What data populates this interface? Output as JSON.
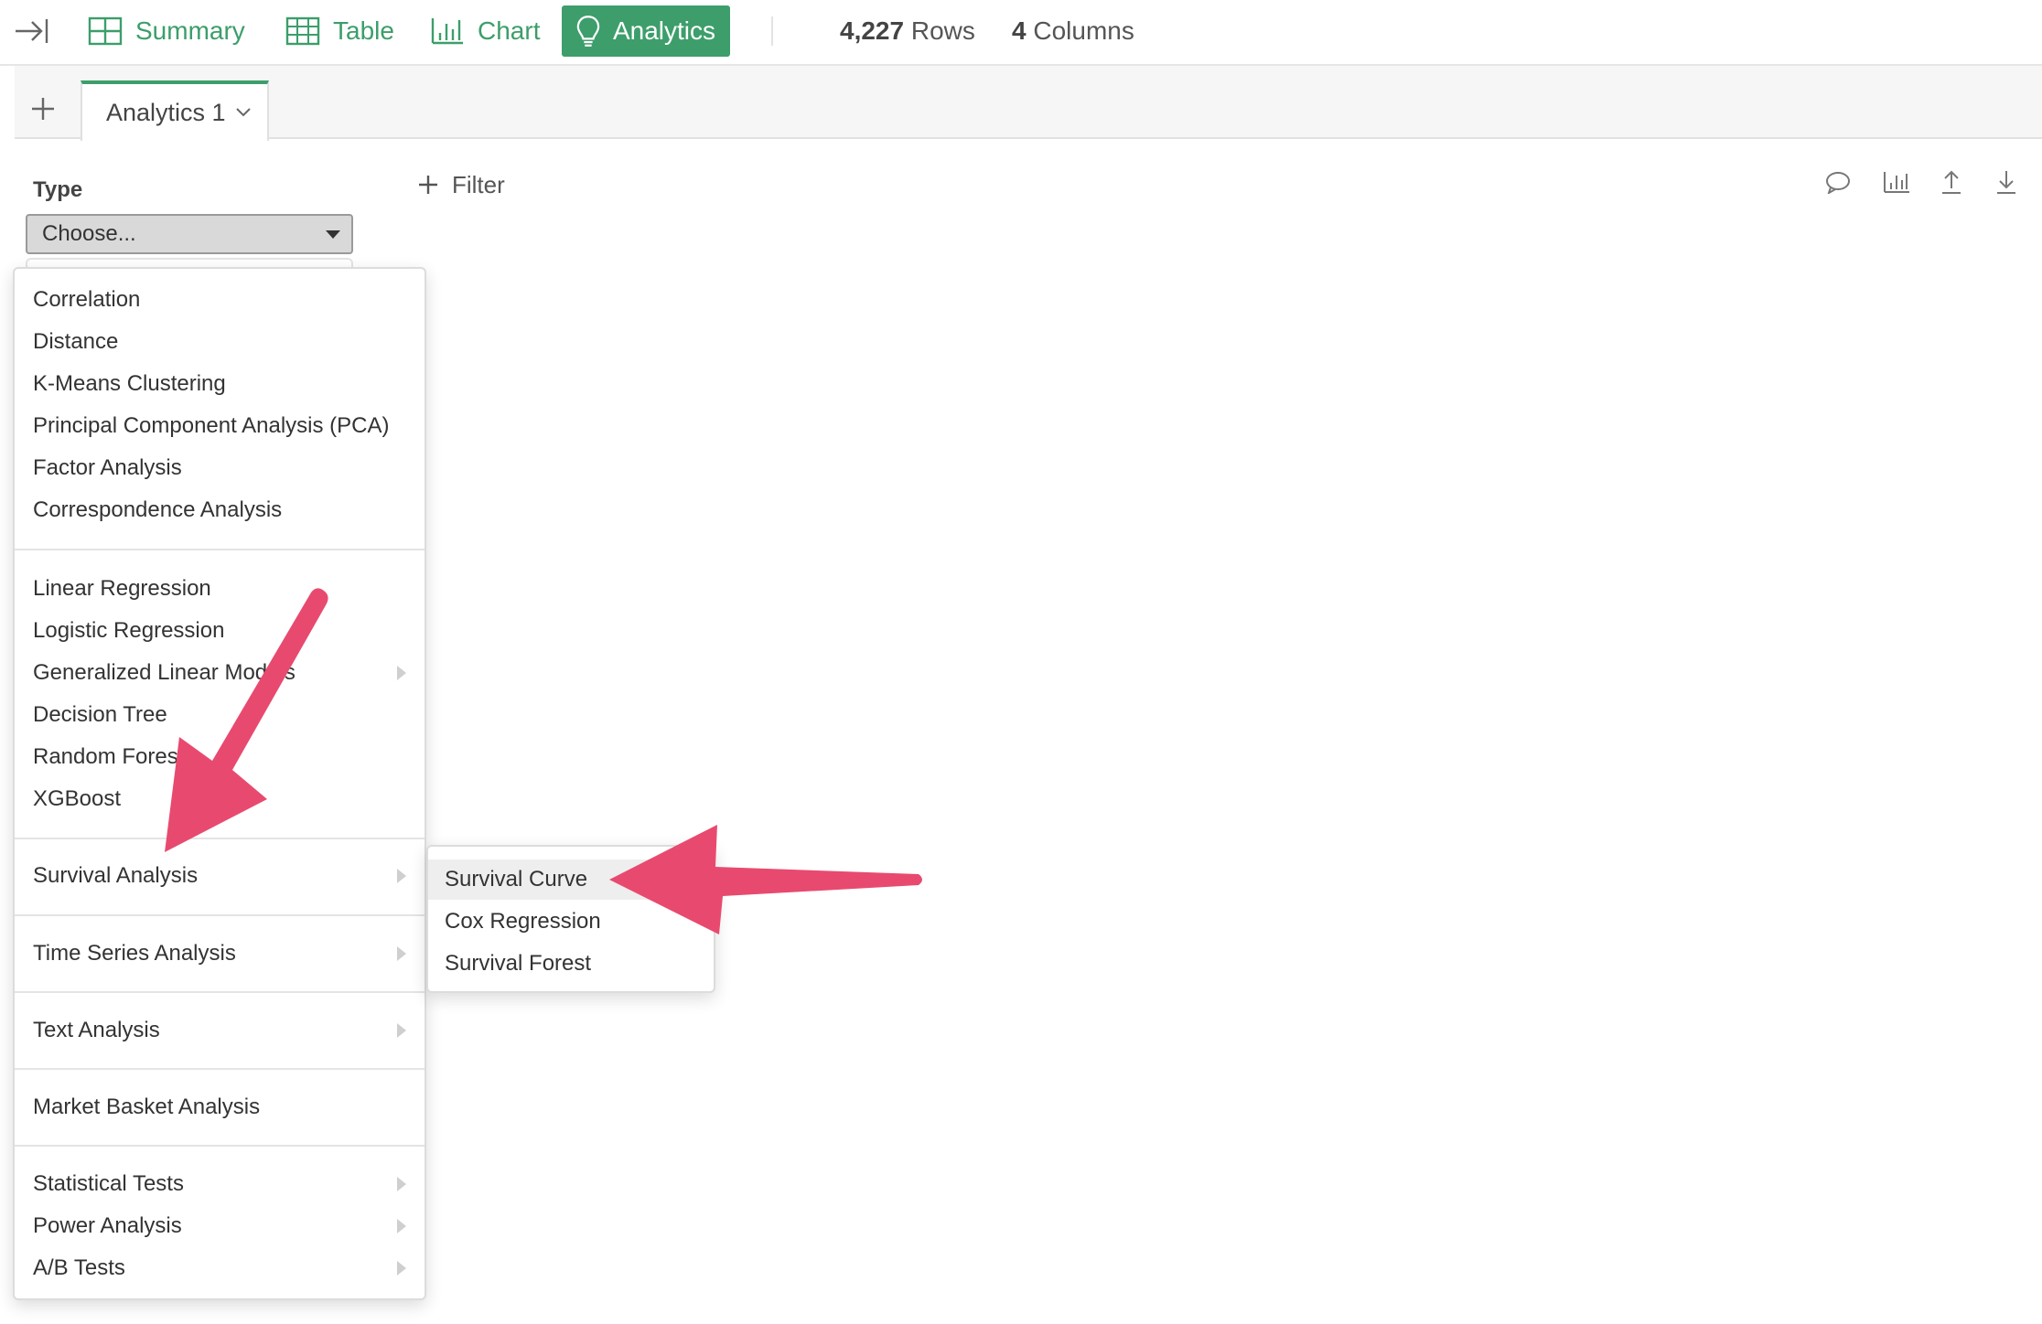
{
  "toolbar": {
    "nav": [
      {
        "label": "Summary",
        "icon": "summary-grid-icon",
        "active": false
      },
      {
        "label": "Table",
        "icon": "table-grid-icon",
        "active": false
      },
      {
        "label": "Chart",
        "icon": "bar-chart-icon",
        "active": false
      },
      {
        "label": "Analytics",
        "icon": "lightbulb-icon",
        "active": true
      }
    ],
    "rows_count": "4,227",
    "rows_label": "Rows",
    "columns_count": "4",
    "columns_label": "Columns"
  },
  "tabs": {
    "add_icon": "plus-icon",
    "items": [
      {
        "label": "Analytics 1",
        "active": true
      }
    ]
  },
  "config": {
    "type_label": "Type",
    "type_select_value": "Choose..."
  },
  "filter": {
    "label": "Filter"
  },
  "right_tools": [
    "comment-icon",
    "chart-icon",
    "upload-icon",
    "download-icon"
  ],
  "menu": {
    "groups": [
      [
        {
          "label": "Correlation",
          "has_submenu": false
        },
        {
          "label": "Distance",
          "has_submenu": false
        },
        {
          "label": "K-Means Clustering",
          "has_submenu": false
        },
        {
          "label": "Principal Component Analysis (PCA)",
          "has_submenu": false
        },
        {
          "label": "Factor Analysis",
          "has_submenu": false
        },
        {
          "label": "Correspondence Analysis",
          "has_submenu": false
        }
      ],
      [
        {
          "label": "Linear Regression",
          "has_submenu": false
        },
        {
          "label": "Logistic Regression",
          "has_submenu": false
        },
        {
          "label": "Generalized Linear Models",
          "has_submenu": true
        },
        {
          "label": "Decision Tree",
          "has_submenu": false
        },
        {
          "label": "Random Forest",
          "has_submenu": false
        },
        {
          "label": "XGBoost",
          "has_submenu": false
        }
      ],
      [
        {
          "label": "Survival Analysis",
          "has_submenu": true
        }
      ],
      [
        {
          "label": "Time Series Analysis",
          "has_submenu": true
        }
      ],
      [
        {
          "label": "Text Analysis",
          "has_submenu": true
        }
      ],
      [
        {
          "label": "Market Basket Analysis",
          "has_submenu": false
        }
      ],
      [
        {
          "label": "Statistical Tests",
          "has_submenu": true
        },
        {
          "label": "Power Analysis",
          "has_submenu": true
        },
        {
          "label": "A/B Tests",
          "has_submenu": true
        }
      ]
    ]
  },
  "submenu": {
    "parent": "Survival Analysis",
    "items": [
      {
        "label": "Survival Curve",
        "highlighted": true
      },
      {
        "label": "Cox Regression",
        "highlighted": false
      },
      {
        "label": "Survival Forest",
        "highlighted": false
      }
    ]
  },
  "colors": {
    "accent_green": "#3d9e6b",
    "annotation_pink": "#e84a6f"
  }
}
